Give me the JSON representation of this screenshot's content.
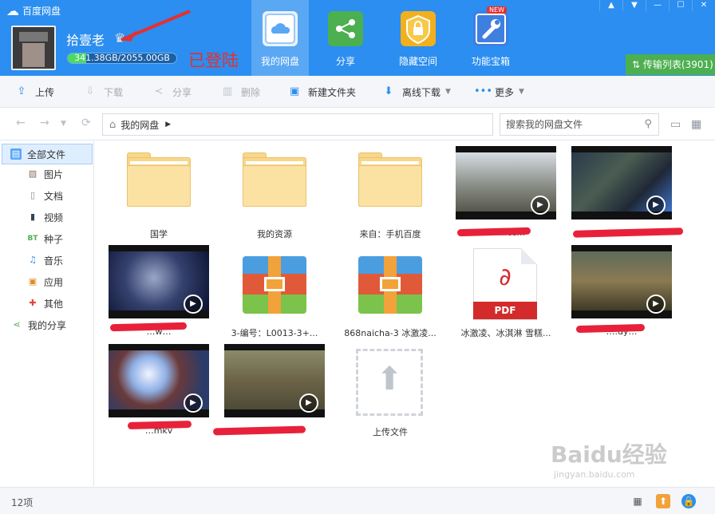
{
  "app": {
    "title": "百度网盘"
  },
  "user": {
    "name": "拾壹老",
    "quota": "341.38GB/2055.00GB",
    "quota_fraction": 0.166
  },
  "overlay_label": "已登陆",
  "nav": [
    {
      "label": "我的网盘",
      "icon": "cloud-icon",
      "color": "#5aa7f4"
    },
    {
      "label": "分享",
      "icon": "share-icon",
      "color": "#4caf50"
    },
    {
      "label": "隐藏空间",
      "icon": "lock-icon",
      "color": "#f2b01e"
    },
    {
      "label": "功能宝箱",
      "icon": "wrench-icon",
      "color": "#3f7fe0",
      "badge": "NEW"
    }
  ],
  "transfer": {
    "label": "传输列表(3901)"
  },
  "toolbar": {
    "upload": "上传",
    "download": "下载",
    "share": "分享",
    "delete": "删除",
    "new_folder": "新建文件夹",
    "offline_download": "离线下载",
    "more": "更多"
  },
  "breadcrumb": {
    "root": "我的网盘"
  },
  "search": {
    "placeholder": "搜索我的网盘文件"
  },
  "sidebar": {
    "items": [
      {
        "label": "全部文件",
        "icon": "all-files-icon"
      },
      {
        "label": "图片",
        "icon": "image-icon"
      },
      {
        "label": "文档",
        "icon": "document-icon"
      },
      {
        "label": "视频",
        "icon": "video-icon"
      },
      {
        "label": "种子",
        "icon": "bt-icon"
      },
      {
        "label": "音乐",
        "icon": "music-icon"
      },
      {
        "label": "应用",
        "icon": "app-icon"
      },
      {
        "label": "其他",
        "icon": "other-icon"
      },
      {
        "label": "我的分享",
        "icon": "share-icon"
      }
    ]
  },
  "files": [
    {
      "name": "国学",
      "type": "folder"
    },
    {
      "name": "我的资源",
      "type": "folder"
    },
    {
      "name": "来自：手机百度",
      "type": "folder"
    },
    {
      "name": "…….cc…",
      "type": "video"
    },
    {
      "name": "",
      "type": "video"
    },
    {
      "name": "…w…",
      "type": "video"
    },
    {
      "name": "3-编号：L0013-3+...",
      "type": "zip"
    },
    {
      "name": "868naicha-3 冰激凌...",
      "type": "zip"
    },
    {
      "name": "冰激凌、冰淇淋 雪糕...",
      "type": "pdf",
      "badge": "PDF"
    },
    {
      "name": "….dy…",
      "type": "video"
    },
    {
      "name": "…mkv",
      "type": "video"
    },
    {
      "name": "….d...",
      "type": "video"
    },
    {
      "name": "上传文件",
      "type": "upload"
    }
  ],
  "status": {
    "count": "12项"
  },
  "watermark": {
    "brand": "Baidu经验",
    "url": "jingyan.baidu.com"
  }
}
